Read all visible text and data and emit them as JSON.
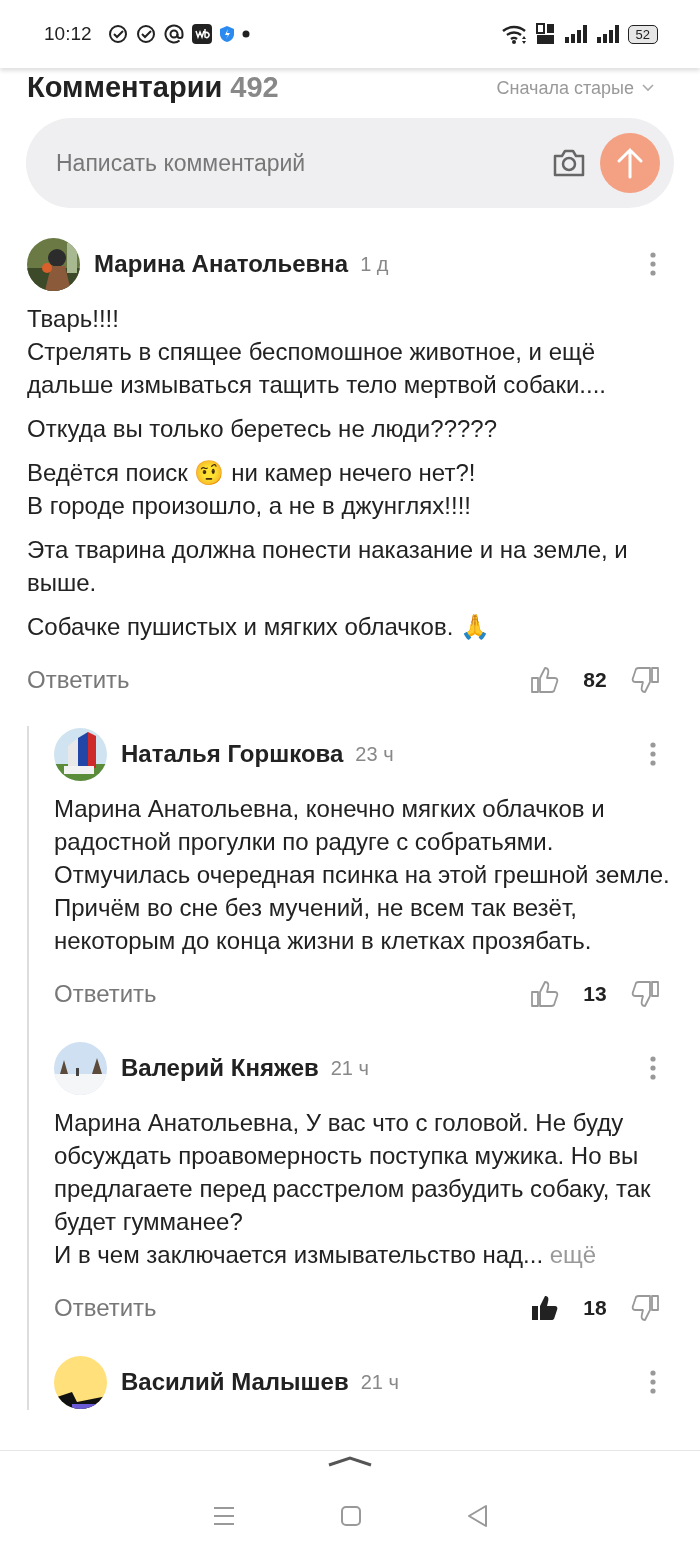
{
  "status_bar": {
    "time": "10:12",
    "battery": "52"
  },
  "header": {
    "title": "Комментарии",
    "count": "492",
    "sort": "Сначала старые"
  },
  "composer": {
    "placeholder": "Написать комментарий"
  },
  "comments": [
    {
      "author": "Марина Анатольевна",
      "age": "1 д",
      "paragraphs": [
        "Тварь!!!!\nСтрелять в спящее беспомошное животное, и ещё дальше измываться тащить тело мертвой собаки....",
        "Откуда вы только беретесь не люди?????",
        "Ведётся поиск 🤨 ни камер нечего нет?!\nВ городе произошло, а не в джунглях!!!!",
        "Эта тварина должна понести наказание и на земле, и выше.",
        "Собачке пушистых и мягких облачков. 🙏"
      ],
      "reply": "Ответить",
      "votes": "82",
      "liked": false,
      "children": [
        {
          "author": "Наталья Горшкова",
          "age": "23 ч",
          "paragraphs": [
            "Марина Анатольевна, конечно мягких облачков и радостной прогулки по радуге с собратьями. Отмучилась очередная псинка на этой грешной земле. Причём во сне без мучений, не всем так везёт, некоторым до конца жизни в клетках прозябать."
          ],
          "reply": "Ответить",
          "votes": "13",
          "liked": false
        },
        {
          "author": "Валерий Княжев",
          "age": "21 ч",
          "paragraphs": [
            "Марина Анатольевна, У вас что с головой. Не буду обсуждать проавомерность поступка мужика. Но вы предлагаете перед расстрелом разбудить собаку, так будет гумманее?\nИ в чем заключается измывательство над..."
          ],
          "more": "ещё",
          "reply": "Ответить",
          "votes": "18",
          "liked": true
        },
        {
          "author": "Василий Малышев",
          "age": "21 ч"
        }
      ]
    }
  ]
}
